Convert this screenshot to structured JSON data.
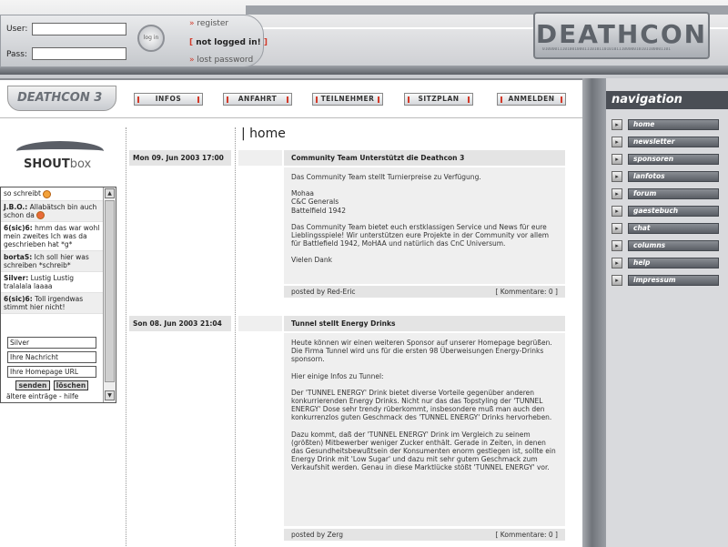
{
  "header": {
    "user_label": "User:",
    "pass_label": "Pass:",
    "login_button": "log in",
    "register_link": "register",
    "status": "not logged in!",
    "lost_password_link": "lost password",
    "logo_text": "DEATHCON",
    "logo_bits": "0100001110100100011101011010101110000010101100001101"
  },
  "navbar": {
    "site_badge": "DEATHCON 3",
    "buttons": [
      "INFOS",
      "ANFAHRT",
      "TEILNEHMER",
      "SITZPLAN",
      "ANMELDEN"
    ]
  },
  "shoutbox": {
    "logo_bold": "SHOUT",
    "logo_light": "box",
    "entries": [
      {
        "who": "",
        "text": "so schreibt"
      },
      {
        "who": "J.B.O.:",
        "text": "Allabätsch bin auch schon da"
      },
      {
        "who": "6(sic)6:",
        "text": "hmm das war wohl mein zweites Ich was da geschrieben hat *g*"
      },
      {
        "who": "bortaS:",
        "text": "Ich soll hier was schreiben *schreib*"
      },
      {
        "who": "Silver:",
        "text": "Lustig Lustig tralalala laaaa"
      },
      {
        "who": "6(sic)6:",
        "text": "Toll irgendwas stimmt hier nicht!"
      }
    ],
    "name_value": "Silver",
    "message_placeholder": "Ihre Nachricht",
    "homepage_placeholder": "Ihre Homepage URL",
    "send_button": "senden",
    "delete_button": "löschen",
    "older_link": "ältere einträge - hilfe"
  },
  "main": {
    "title": "| home",
    "news": [
      {
        "date": "Mon 09. Jun 2003 17:00",
        "title": "Community Team Unterstützt die Deathcon 3",
        "paragraphs": [
          "Das Community Team stellt Turnierpreise zu Verfügung.",
          "Mohaa\nC&C Generals\nBattelfield 1942",
          "Das Community Team bietet euch erstklassigen Service und News für eure Lieblingsspiele! Wir unterstützen eure Projekte in der Community vor allem für Battlefield 1942, MoHAA und natürlich das CnC Universum.",
          "Vielen Dank"
        ],
        "author": "posted by Red-Eric",
        "comments": "[ Kommentare: 0 ]"
      },
      {
        "date": "Son 08. Jun 2003 21:04",
        "title": "Tunnel stellt Energy Drinks",
        "paragraphs": [
          "Heute können wir einen weiteren Sponsor auf unserer Homepage begrüßen. Die Firma Tunnel wird uns für die ersten 98 Überweisungen Energy-Drinks sponsorn.",
          "Hier einige Infos zu Tunnel:",
          "Der 'TUNNEL ENERGY' Drink bietet diverse Vorteile gegenüber anderen konkurrierenden Energy Drinks. Nicht nur das das Topstyling der 'TUNNEL ENERGY' Dose sehr trendy rüberkommt, insbesondere muß man auch den konkurrenzlos guten Geschmack des 'TUNNEL ENERGY' Drinks hervorheben.",
          "Dazu kommt, daß der 'TUNNEL ENERGY' Drink im Vergleich zu seinem (größten) Mitbewerber weniger Zucker enthält. Gerade in Zeiten, in denen das Gesundheitsbewußtsein der Konsumenten enorm gestiegen ist, sollte ein Energy Drink mit 'Low Sugar' und dazu mit sehr gutem Geschmack zum Verkaufshit werden. Genau in diese Marktlücke stößt 'TUNNEL ENERGY' vor."
        ],
        "author": "posted by Zerg",
        "comments": "[ Kommentare: 0 ]"
      }
    ]
  },
  "navigation": {
    "heading": "navigation",
    "items": [
      "home",
      "newsletter",
      "sponsoren",
      "lanfotos",
      "forum",
      "gaestebuch",
      "chat",
      "columns",
      "help",
      "impressum"
    ]
  },
  "colors": {
    "accent_red": "#d23a2a",
    "nav_dark": "#4a4e55",
    "panel_gray": "#d9dadd"
  }
}
